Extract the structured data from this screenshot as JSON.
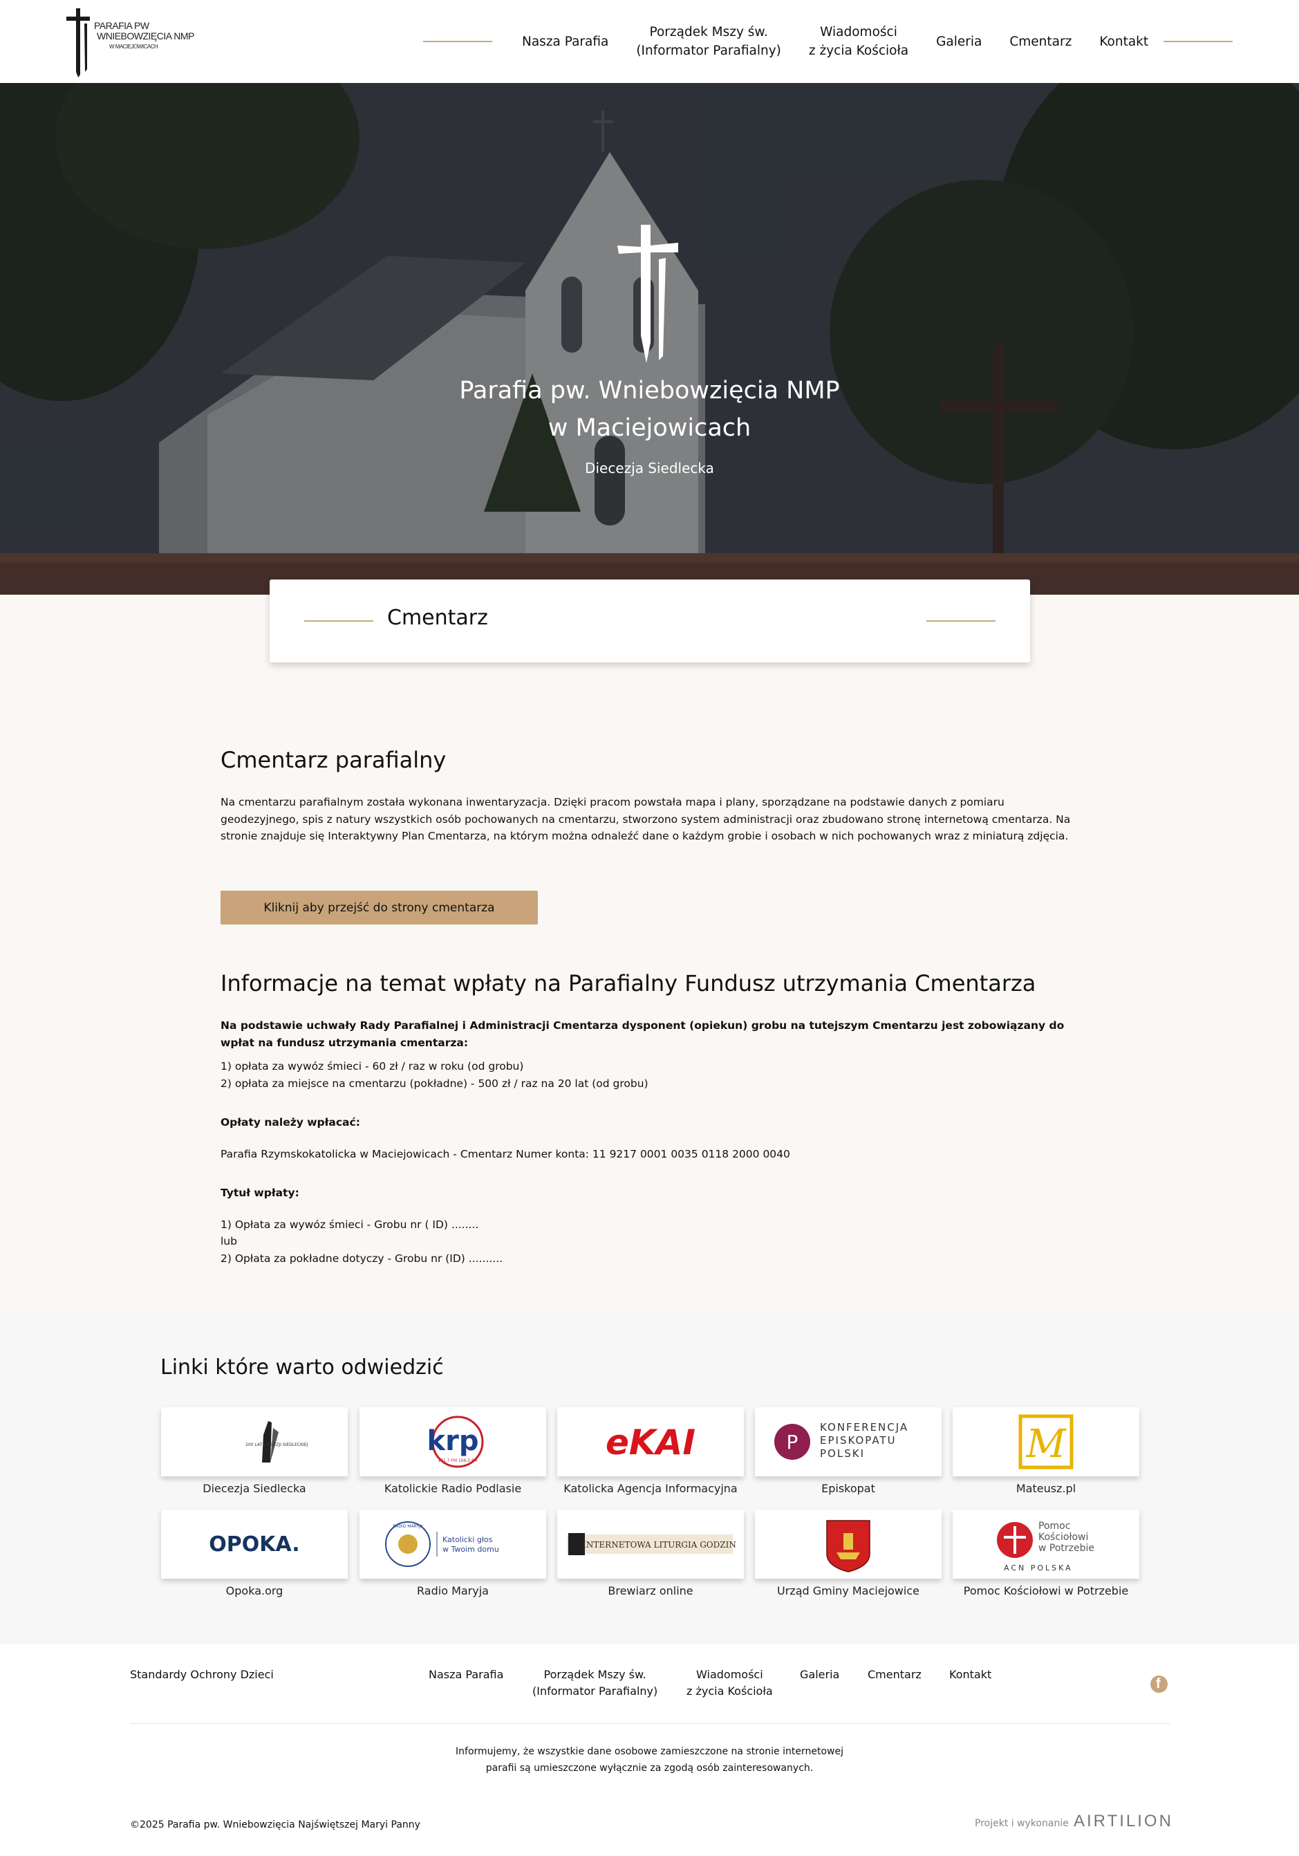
{
  "header": {
    "logo": {
      "line1": "PARAFIA PW",
      "line2": "WNIEBOWZIĘCIA NMP",
      "line3": "W MACIEJOWICACH"
    },
    "nav": [
      {
        "label": "Nasza Parafia"
      },
      {
        "label": "Porządek Mszy św.\n(Informator Parafialny)"
      },
      {
        "label": "Wiadomości\nz życia Kościoła"
      },
      {
        "label": "Galeria"
      },
      {
        "label": "Cmentarz"
      },
      {
        "label": "Kontakt"
      }
    ]
  },
  "hero": {
    "title_line1": "Parafia pw. Wniebowzięcia NMP",
    "title_line2": "w Maciejowicach",
    "subtitle": "Diecezja Siedlecka"
  },
  "page_title": "Cmentarz",
  "section1": {
    "heading": "Cmentarz parafialny",
    "body": "Na cmentarzu parafialnym została wykonana inwentaryzacja. Dzięki pracom powstała mapa i plany, sporządzane na podstawie danych z pomiaru geodezyjnego, spis z natury wszystkich osób pochowanych na cmentarzu, stworzono system administracji oraz zbudowano stronę internetową cmentarza. Na stronie znajduje się Interaktywny Plan Cmentarza, na którym można odnaleźć dane o każdym grobie i osobach w nich pochowanych wraz z miniaturą zdjęcia.",
    "button": "Kliknij aby przejść do strony cmentarza"
  },
  "section2": {
    "heading": "Informacje na temat wpłaty na Parafialny Fundusz utrzymania Cmentarza",
    "intro": "Na podstawie uchwały Rady Parafialnej i Administracji Cmentarza dysponent (opiekun) grobu na tutejszym Cmentarzu jest zobowiązany do wpłat na fundusz utrzymania cmentarza:",
    "fee1": "1) opłata za wywóz śmieci - 60 zł / raz w roku (od grobu)",
    "fee2": "2) opłata za miejsce na cmentarzu (pokładne) - 500 zł / raz na 20 lat (od grobu)",
    "pay_heading": "Opłaty należy wpłacać:",
    "account": "Parafia Rzymskokatolicka w Maciejowicach - Cmentarz Numer konta: 11 9217 0001 0035 0118 2000 0040",
    "title_heading": "Tytuł wpłaty:",
    "title1": "1) Opłata za wywóz śmieci - Grobu nr ( ID) ........",
    "title_or": "lub",
    "title2": "2) Opłata za pokładne dotyczy - Grobu nr (ID) .........."
  },
  "links": {
    "heading": "Linki które warto odwiedzić",
    "items": [
      {
        "label": "Diecezja Siedlecka",
        "logo_text": "200 LAT DIECEZJI SIEDLECKIEJ"
      },
      {
        "label": "Katolickie Radio Podlasie",
        "logo_text": "krp",
        "logo_sub": "101,7 FM 106,0 FM"
      },
      {
        "label": "Katolicka Agencja Informacyjna",
        "logo_text": "eKAI"
      },
      {
        "label": "Episkopat",
        "logo_text": "KONFERENCJA\nEPISKOPATU\nPOLSKI"
      },
      {
        "label": "Mateusz.pl",
        "logo_text": "M"
      },
      {
        "label": "Opoka.org",
        "logo_text": "OPOKA."
      },
      {
        "label": "Radio Maryja",
        "logo_text": "Katolicki głos\nw Twoim domu",
        "logo_ring": "RADIO MARYJA"
      },
      {
        "label": "Brewiarz online",
        "logo_text": "INTERNETOWA LITURGIA GODZIN"
      },
      {
        "label": "Urząd Gminy Maciejowice",
        "logo_text": ""
      },
      {
        "label": "Pomoc Kościołowi w Potrzebie",
        "logo_text": "Pomoc\nKościołowi\nw Potrzebie",
        "logo_sub": "ACN  POLSKA"
      }
    ]
  },
  "footer": {
    "left_link": "Standardy Ochrony Dzieci",
    "nav": [
      {
        "label": "Nasza Parafia"
      },
      {
        "label": "Porządek Mszy św.\n(Informator Parafialny)"
      },
      {
        "label": "Wiadomości\nz życia Kościoła"
      },
      {
        "label": "Galeria"
      },
      {
        "label": "Cmentarz"
      },
      {
        "label": "Kontakt"
      }
    ],
    "note": "Informujemy, że wszystkie dane osobowe zamieszczone na stronie internetowej\nparafii są umieszczone wyłącznie za zgodą osób zainteresowanych.",
    "copyright": "©2025 Parafia pw. Wniebowzięcia Najświętszej Maryi Panny",
    "credit": "Projekt i wykonanie",
    "brand": "AIRTILION"
  },
  "colors": {
    "accent": "#c9a47a",
    "accent_line": "#c9a87c",
    "beige_bg": "#faf7f4",
    "links_bg": "#f7f7f7"
  }
}
